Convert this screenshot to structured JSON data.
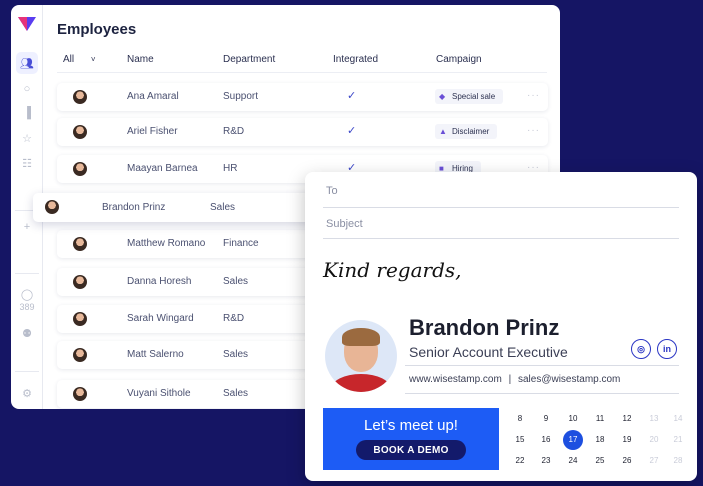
{
  "app": {
    "title": "Employees",
    "columns": [
      "All",
      "Name",
      "Department",
      "Integrated",
      "Campaign"
    ],
    "rail_count": "389",
    "rows": [
      {
        "name": "Ana Amaral",
        "department": "Support",
        "integrated": "✓",
        "campaign": "Special sale"
      },
      {
        "name": "Ariel Fisher",
        "department": "R&D",
        "integrated": "✓",
        "campaign": "Disclaimer"
      },
      {
        "name": "Maayan Barnea",
        "department": "HR",
        "integrated": "✓",
        "campaign": "Hiring"
      },
      {
        "name": "Matthew Romano",
        "department": "Finance"
      },
      {
        "name": "Danna Horesh",
        "department": "Sales"
      },
      {
        "name": "Sarah Wingard",
        "department": "R&D"
      },
      {
        "name": "Matt Salerno",
        "department": "Sales"
      },
      {
        "name": "Vuyani Sithole",
        "department": "Sales"
      }
    ],
    "dragged_row": {
      "name": "Brandon Prinz",
      "department": "Sales"
    },
    "more_glyph": "···"
  },
  "email": {
    "to_label": "To",
    "subject_label": "Subject",
    "signoff": "Kind regards,",
    "signature": {
      "name": "Brandon Prinz",
      "role": "Senior Account Executive",
      "website": "www.wisestamp.com",
      "separator": "|",
      "email": "sales@wisestamp.com",
      "social": [
        "instagram-icon",
        "linkedin-icon"
      ]
    },
    "cta": {
      "title": "Let’s meet up!",
      "button": "BOOK A DEMO"
    },
    "calendar": {
      "rows": [
        [
          "8",
          "9",
          "10",
          "11",
          "12",
          "13",
          "14"
        ],
        [
          "15",
          "16",
          "17",
          "18",
          "19",
          "20",
          "21"
        ],
        [
          "22",
          "23",
          "24",
          "25",
          "26",
          "27",
          "28"
        ]
      ],
      "selected": "17"
    }
  },
  "colors": {
    "background": "#151564",
    "accent": "#1d5cf5",
    "selected_day": "#1d4fe0",
    "cta_button": "#131a6b"
  }
}
